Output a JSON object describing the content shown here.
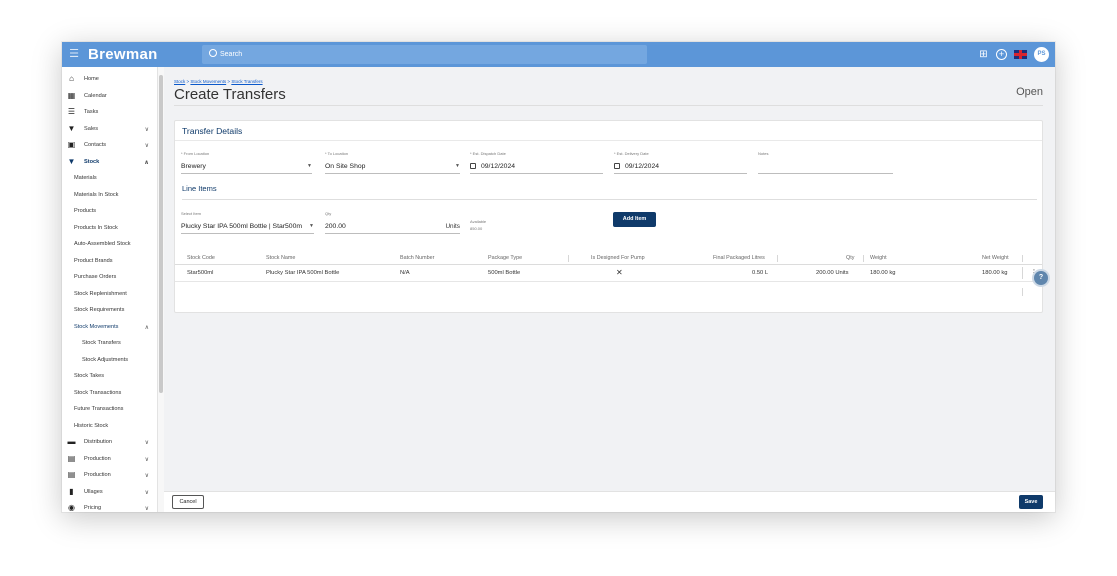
{
  "app": {
    "brand": "Brewman"
  },
  "search": {
    "label": "Search"
  },
  "topbar": {
    "avatar": "PS"
  },
  "sidebar": {
    "items": [
      {
        "label": "Home",
        "icon": "home-icon"
      },
      {
        "label": "Calendar",
        "icon": "calendar-icon"
      },
      {
        "label": "Tasks",
        "icon": "list-icon"
      },
      {
        "label": "Sales",
        "icon": "cart-icon"
      },
      {
        "label": "Contacts",
        "icon": "contacts-icon"
      },
      {
        "label": "Stock",
        "icon": "filter-icon"
      },
      {
        "label": "Materials"
      },
      {
        "label": "Materials In Stock"
      },
      {
        "label": "Products"
      },
      {
        "label": "Products In Stock"
      },
      {
        "label": "Auto-Assembled Stock"
      },
      {
        "label": "Product Brands"
      },
      {
        "label": "Purchase Orders"
      },
      {
        "label": "Stock Replenishment"
      },
      {
        "label": "Stock Requirements"
      },
      {
        "label": "Stock Movements"
      },
      {
        "label": "Stock Transfers"
      },
      {
        "label": "Stock Adjustments"
      },
      {
        "label": "Stock Takes"
      },
      {
        "label": "Stock Transactions"
      },
      {
        "label": "Future Transactions"
      },
      {
        "label": "Historic Stock"
      },
      {
        "label": "Distribution",
        "icon": "truck-icon"
      },
      {
        "label": "Production",
        "icon": "production-icon"
      },
      {
        "label": "Production",
        "icon": "production-icon"
      },
      {
        "label": "Ullages",
        "icon": "trash-icon"
      },
      {
        "label": "Pricing",
        "icon": "pricing-icon"
      }
    ]
  },
  "breadcrumb": {
    "part1": "Stock",
    "sep1": " > ",
    "part2": "Stock Movements",
    "sep2": " > ",
    "part3": "Stock Transfers"
  },
  "page": {
    "title": "Create Transfers",
    "status": "Open"
  },
  "transfer": {
    "section_title": "Transfer Details",
    "from_label": "* From Location",
    "from_value": "Brewery",
    "to_label": "* To Location",
    "to_value": "On Site Shop",
    "dispatch_label": "* Est. Dispatch Date",
    "dispatch_value": "09/12/2024",
    "delivery_label": "* Est. Delivery Date",
    "delivery_value": "09/12/2024",
    "notes_label": "Notes",
    "notes_value": ""
  },
  "line_items": {
    "section_title": "Line Items",
    "select_label": "Select Item",
    "select_value": "Plucky Star IPA 500ml Bottle | Star500m",
    "qty_label": "Qty",
    "qty_value": "200.00",
    "qty_unit": "Units",
    "available_label": "Available",
    "available_value": "850.00",
    "add_button": "Add Item"
  },
  "table": {
    "headers": [
      "Stock Code",
      "Stock Name",
      "Batch Number",
      "Package Type",
      "Is Designed For Pump",
      "Final Packaged Litres",
      "Qty",
      "Weight",
      "Net Weight"
    ],
    "rows": [
      [
        "Star500ml",
        "Plucky Star IPA 500ml Bottle",
        "N/A",
        "500ml Bottle",
        "✕",
        "0.50 L",
        "200.00 Units",
        "180.00 kg",
        "180.00 kg"
      ]
    ]
  },
  "footer": {
    "cancel": "Cancel",
    "save": "Save"
  },
  "colors": {
    "topbar": "#5c96d8",
    "accent": "#0f3a6a",
    "link": "#0a58ca"
  }
}
